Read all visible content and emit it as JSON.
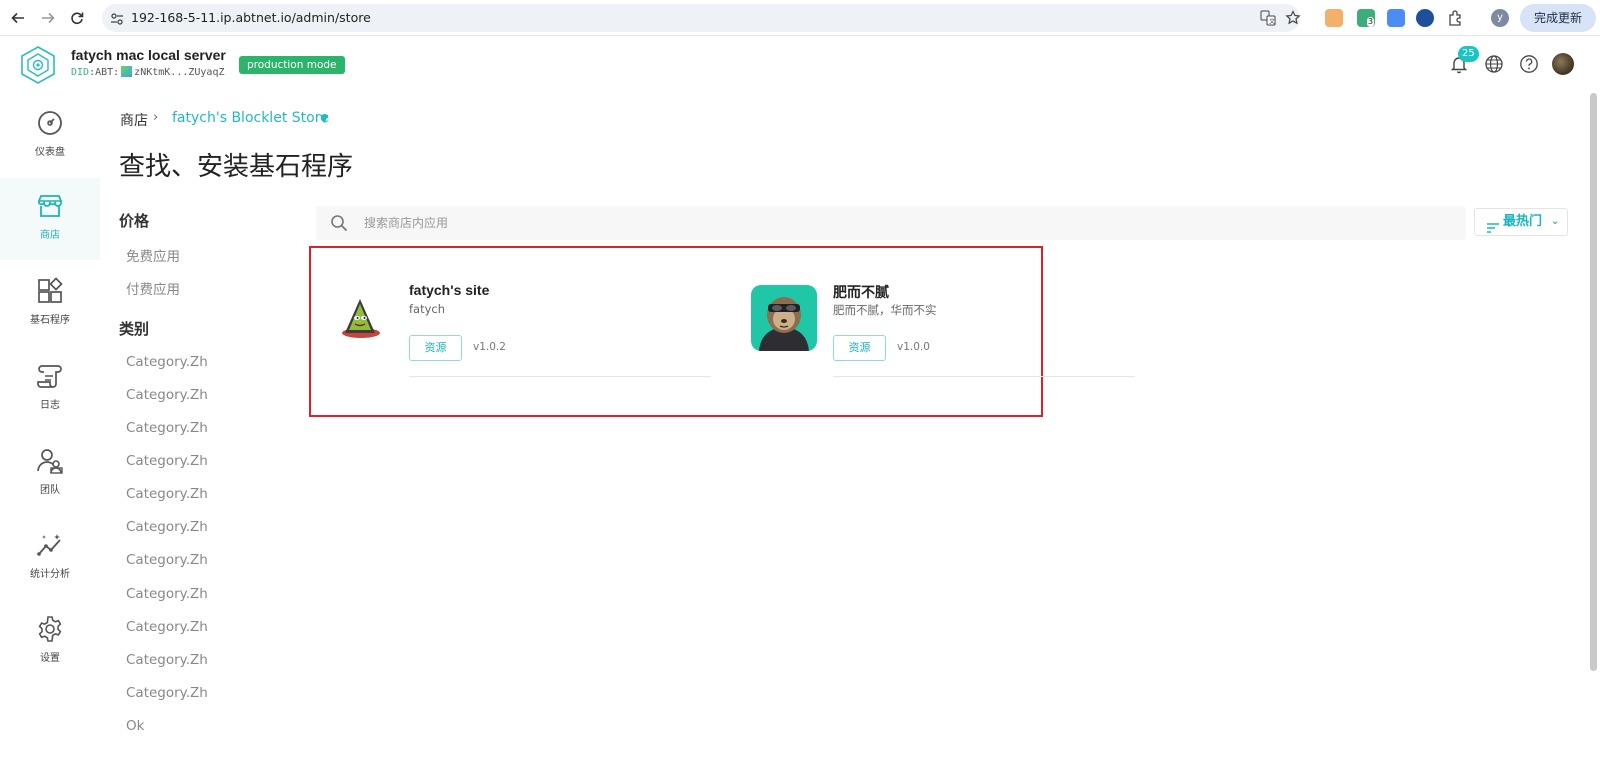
{
  "browser": {
    "url": "192-168-5-11.ip.abtnet.io/admin/store",
    "update_label": "完成更新",
    "profile_initial": "y",
    "extension_badge": "3"
  },
  "header": {
    "server_name": "fatych mac local server",
    "did_prefix": "DID",
    "did_type": ":ABT:",
    "did_value": "zNKtmK...ZUyaqZ",
    "mode_badge": "production mode",
    "notification_count": "25"
  },
  "sidebar": {
    "items": [
      {
        "label": "仪表盘",
        "icon": "dashboard-icon",
        "active": false
      },
      {
        "label": "商店",
        "icon": "store-icon",
        "active": true
      },
      {
        "label": "基石程序",
        "icon": "blocklets-icon",
        "active": false
      },
      {
        "label": "日志",
        "icon": "logs-icon",
        "active": false
      },
      {
        "label": "团队",
        "icon": "team-icon",
        "active": false
      },
      {
        "label": "统计分析",
        "icon": "analytics-icon",
        "active": false
      },
      {
        "label": "设置",
        "icon": "settings-icon",
        "active": false
      }
    ]
  },
  "breadcrumb": {
    "root": "商店",
    "separator": "›",
    "store": "fatych's Blocklet Store"
  },
  "page_title": "查找、安装基石程序",
  "filters": {
    "price_heading": "价格",
    "price_items": [
      "免费应用",
      "付费应用"
    ],
    "category_heading": "类别",
    "category_items": [
      "Category.Zh",
      "Category.Zh",
      "Category.Zh",
      "Category.Zh",
      "Category.Zh",
      "Category.Zh",
      "Category.Zh",
      "Category.Zh",
      "Category.Zh",
      "Category.Zh",
      "Category.Zh",
      "Ok"
    ]
  },
  "search": {
    "placeholder": "搜索商店内应用",
    "value": ""
  },
  "sort": {
    "label": "最热门"
  },
  "apps": [
    {
      "title": "fatych's site",
      "subtitle": "fatych",
      "button": "资源",
      "version": "v1.0.2"
    },
    {
      "title": "肥而不腻",
      "subtitle": "肥而不腻，华而不实",
      "button": "资源",
      "version": "v1.0.0"
    }
  ],
  "colors": {
    "accent": "#1bb5b5",
    "badge_green": "#2bb46a",
    "highlight_red": "#d7232b"
  }
}
